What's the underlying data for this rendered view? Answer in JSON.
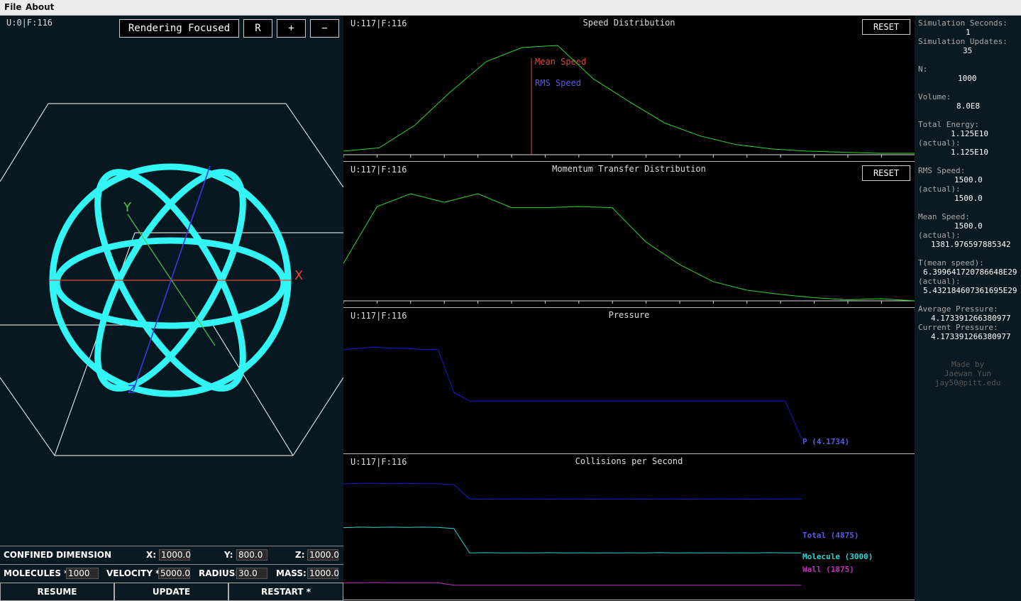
{
  "menu": {
    "file": "File",
    "about": "About"
  },
  "simulation": {
    "counter": "U:0|F:116",
    "render_button": "Rendering Focused",
    "r_button": "R",
    "plus_button": "+",
    "minus_button": "−",
    "axis_x": "X",
    "axis_y": "Y",
    "axis_z": "Z",
    "colors": {
      "molecules": "#33f5f5",
      "x_axis": "#d84a3a",
      "y_axis": "#4ac84a",
      "z_axis": "#3a3ae0"
    }
  },
  "controls": {
    "confined_label": "CONFINED DIMENSION",
    "x_label": "X:",
    "x_value": "1000.0",
    "y_label": "Y:",
    "y_value": "800.0",
    "z_label": "Z:",
    "z_value": "1000.0",
    "molecules_label": "MOLECULES *:",
    "molecules_value": "1000",
    "velocity_label": "VELOCITY *:",
    "velocity_value": "5000.0",
    "radius_label": "RADIUS:",
    "radius_value": "30.0",
    "mass_label": "MASS:",
    "mass_value": "1000.0",
    "resume_button": "RESUME",
    "update_button": "UPDATE",
    "restart_button": "RESTART *"
  },
  "charts": {
    "reset_label": "RESET",
    "speed": {
      "counter": "U:117|F:116",
      "title": "Speed Distribution",
      "mean_label": "Mean Speed",
      "rms_label": "RMS Speed"
    },
    "momentum": {
      "counter": "U:117|F:116",
      "title": "Momentum Transfer Distribution"
    },
    "pressure": {
      "counter": "U:117|F:116",
      "title": "Pressure",
      "series_label": "P (4.1734)"
    },
    "collisions": {
      "counter": "U:117|F:116",
      "title": "Collisions per Second",
      "total_label": "Total (4875)",
      "molecule_label": "Molecule (3000)",
      "wall_label": "Wall (1875)"
    }
  },
  "chart_data": [
    {
      "type": "line",
      "title": "Speed Distribution",
      "series": [
        {
          "values": [
            0.02,
            0.05,
            0.26,
            0.57,
            0.85,
            0.98,
            1.0,
            0.69,
            0.48,
            0.28,
            0.16,
            0.08,
            0.04,
            0.02,
            0.01,
            0.0,
            0.0
          ]
        }
      ],
      "markers": [
        "Mean Speed",
        "RMS Speed"
      ],
      "ylim": [
        0,
        1
      ],
      "grid": false,
      "color": "#2fd52f"
    },
    {
      "type": "line",
      "title": "Momentum Transfer Distribution",
      "series": [
        {
          "values": [
            0.35,
            0.88,
            1.0,
            0.92,
            1.0,
            0.87,
            0.87,
            0.88,
            0.87,
            0.55,
            0.34,
            0.18,
            0.1,
            0.06,
            0.03,
            0.01,
            0.02,
            0.0
          ]
        }
      ],
      "ylim": [
        0,
        1
      ],
      "grid": false,
      "color": "#2fd52f"
    },
    {
      "type": "line",
      "title": "Pressure",
      "series": [
        {
          "name": "P (4.1734)",
          "values": [
            4.6,
            4.61,
            4.62,
            4.61,
            4.61,
            4.6,
            4.6,
            4.25,
            4.18,
            4.18,
            4.18,
            4.18,
            4.18,
            4.18,
            4.18,
            4.18,
            4.18,
            4.18,
            4.18,
            4.18,
            4.18,
            4.18,
            4.18,
            4.18,
            4.18,
            4.18,
            4.18,
            4.18,
            4.18,
            3.88
          ]
        }
      ],
      "ylim": [
        3.85,
        4.65
      ],
      "grid": false,
      "color": "#1a1ad0"
    },
    {
      "type": "line",
      "title": "Collisions per Second",
      "series": [
        {
          "name": "Total (4875)",
          "values": [
            5400,
            5420,
            5420,
            5410,
            5420,
            5410,
            5410,
            5380,
            4880,
            4870,
            4880,
            4875,
            4880,
            4870,
            4880,
            4875,
            4870,
            4880,
            4875,
            4870,
            4880,
            4875,
            4870,
            4880,
            4875,
            4880,
            4870,
            4880,
            4875,
            4875
          ]
        },
        {
          "name": "Molecule (3000)",
          "values": [
            3880,
            3900,
            3890,
            3900,
            3890,
            3900,
            3890,
            3850,
            3000,
            3010,
            3000,
            3005,
            3000,
            3010,
            3000,
            3005,
            3000,
            3000,
            3005,
            3000,
            3010,
            3000,
            3005,
            3000,
            3000,
            3005,
            3000,
            3010,
            3000,
            3000
          ]
        },
        {
          "name": "Wall (1875)",
          "values": [
            1960,
            1960,
            1970,
            1960,
            1960,
            1960,
            1960,
            1880,
            1875,
            1875,
            1875,
            1875,
            1875,
            1875,
            1875,
            1875,
            1875,
            1875,
            1875,
            1875,
            1875,
            1875,
            1875,
            1875,
            1875,
            1875,
            1875,
            1875,
            1875,
            1875
          ]
        }
      ],
      "ylim": [
        1500,
        5700
      ],
      "grid": false,
      "colors": [
        "#1a1ad0",
        "#2fd5d5",
        "#c030c0"
      ]
    }
  ],
  "stats": {
    "sim_seconds_label": "Simulation Seconds:",
    "sim_seconds": "1",
    "sim_updates_label": "Simulation Updates:",
    "sim_updates": "35",
    "n_label": "N:",
    "n": "1000",
    "volume_label": "Volume:",
    "volume": "8.0E8",
    "energy_label": "Total Energy:",
    "energy": "1.125E10",
    "energy_actual_label": "(actual):",
    "energy_actual": "1.125E10",
    "rms_label": "RMS Speed:",
    "rms": "1500.0",
    "rms_actual_label": "(actual):",
    "rms_actual": "1500.0",
    "mean_label": "Mean Speed:",
    "mean": "1500.0",
    "mean_actual_label": "(actual):",
    "mean_actual": "1381.976597885342",
    "t_label": "T(mean speed):",
    "t": "6.399641720786648E29",
    "t_actual_label": "(actual):",
    "t_actual": "5.432184607361695E29",
    "avg_pressure_label": "Average Pressure:",
    "avg_pressure": "4.173391266380977",
    "cur_pressure_label": "Current Pressure:",
    "cur_pressure": "4.173391266380977",
    "credit_1": "Made by",
    "credit_2": "Jaewan Yun",
    "credit_3": "jay50@pitt.edu"
  }
}
